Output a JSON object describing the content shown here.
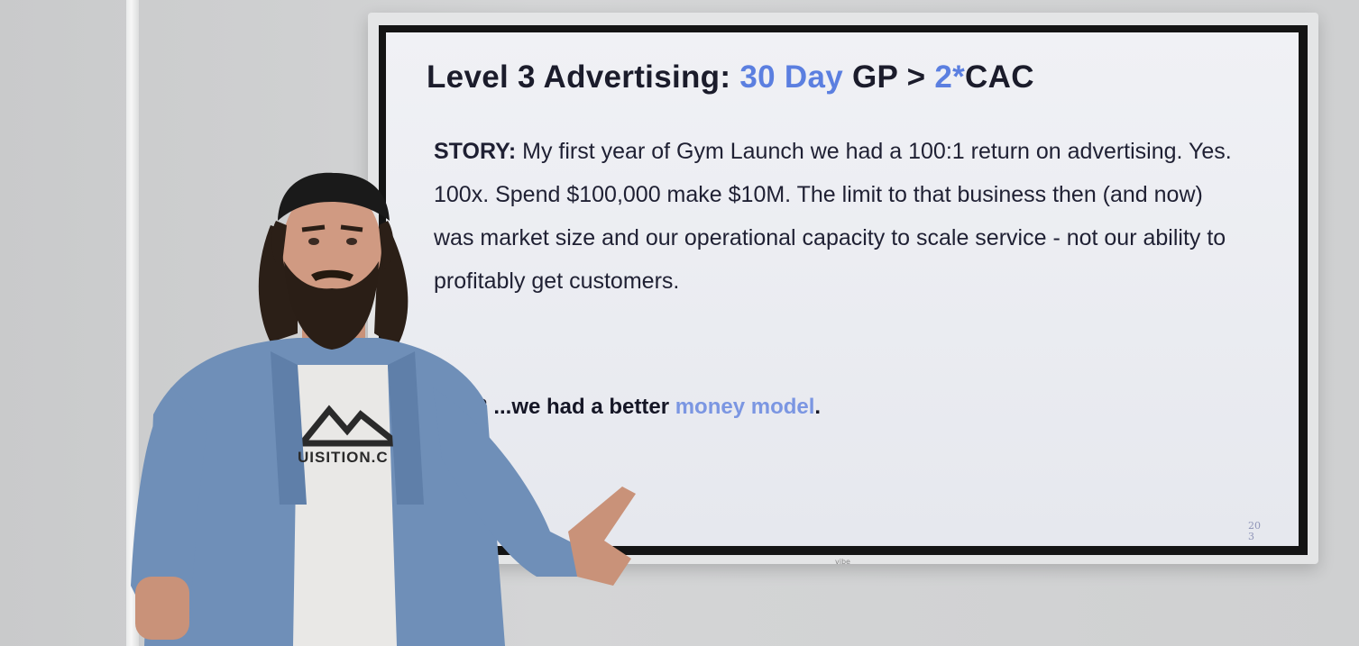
{
  "slide": {
    "title": {
      "part1": "Level 3 Advertising: ",
      "part2": "30 Day",
      "part3": " GP > ",
      "part4": "2*",
      "part5": "CAC"
    },
    "story_label": "STORY:",
    "story_text": " My first year of Gym Launch we had a 100:1 return on advertising. Yes. 100x. Spend $100,000 make $10M. The limit to that business then (and now) was market size  and our operational capacity to scale service - not our ability to profitably get customers.",
    "punchline": {
      "lead": "? ...we had a better ",
      "highlight": "money model",
      "tail": "."
    },
    "page_number": "203"
  },
  "tv": {
    "brand": "vibe"
  },
  "shirt": {
    "text": "UISITION.C"
  },
  "colors": {
    "accent_blue": "#5b7fe0",
    "title_dark": "#1b1c2b",
    "shirt_blue": "#6f8fb8"
  }
}
